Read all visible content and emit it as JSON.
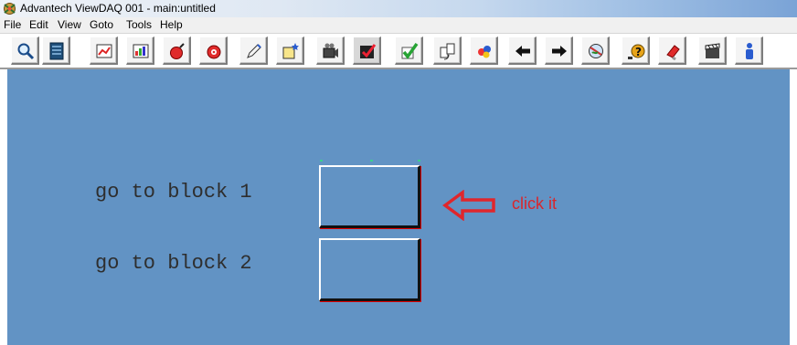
{
  "window": {
    "title": "Advantech ViewDAQ 001 - main:untitled"
  },
  "menu": {
    "items": [
      "File",
      "Edit",
      "View",
      "Goto",
      "Tools",
      "Help"
    ]
  },
  "toolbar": {
    "buttons": [
      "magnifier-icon",
      "database-icon",
      "chart-icon",
      "report-icon",
      "red-bomb-icon",
      "red-bell-icon",
      "pencil-icon",
      "edit-star-icon",
      "camera-icon",
      "checkbox-red-icon",
      "checkmark-icon",
      "document-copy-icon",
      "cube-colors-icon",
      "arrow-left-icon",
      "arrow-right-icon",
      "globe-icon",
      "help-icon",
      "magnet-icon",
      "clapperboard-icon",
      "person-icon"
    ],
    "pressed": [
      "checkbox-red-icon"
    ]
  },
  "canvas": {
    "background": "#6293c4",
    "label_1": "go to block 1",
    "label_2": "go to block 2",
    "annotation": "click it",
    "annotation_color": "#d9262c"
  }
}
